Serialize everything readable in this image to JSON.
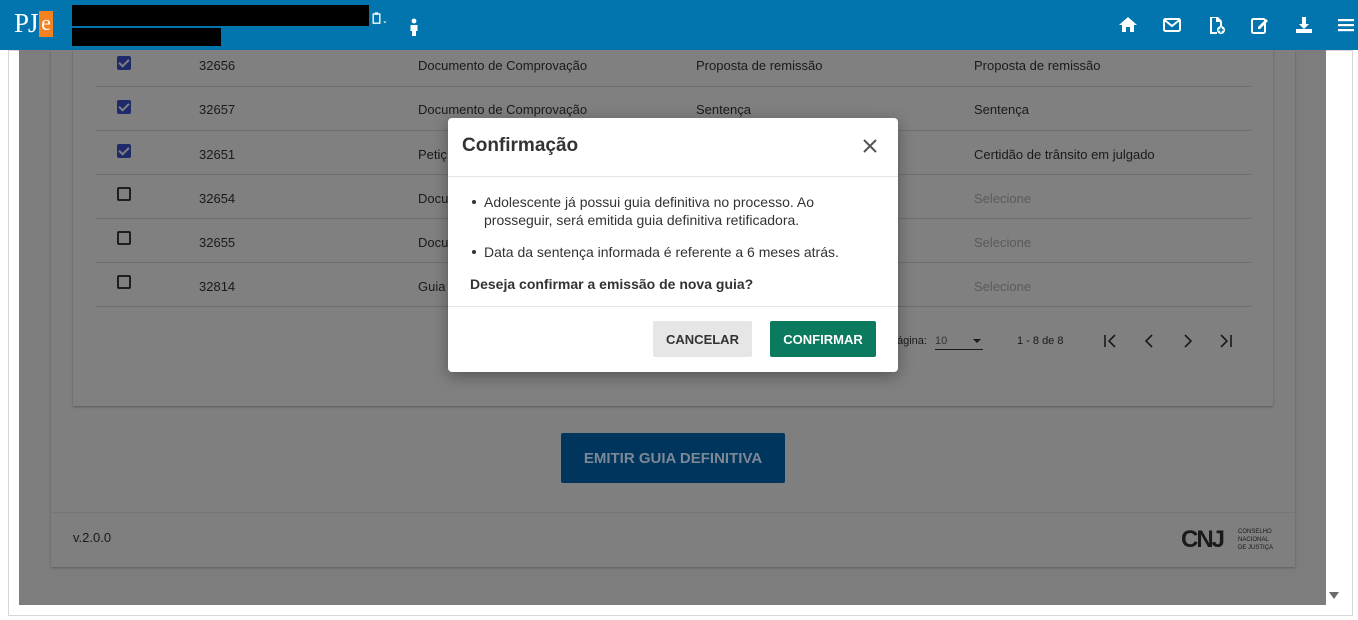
{
  "header": {
    "logo_text": "PJ",
    "logo_accent": "e",
    "bg_color": "#0275ae",
    "icons": [
      "document-dropdown-icon",
      "person-icon",
      "home-icon",
      "mail-icon",
      "document-add-icon",
      "edit-icon",
      "download-icon",
      "menu-icon"
    ]
  },
  "table": {
    "rows": [
      {
        "id": "32656",
        "doc": "Documento de Comprovação",
        "type": "Proposta de remissão",
        "sel": "Proposta de remissão",
        "checked": true
      },
      {
        "id": "32657",
        "doc": "Documento de Comprovação",
        "type": "Sentença",
        "sel": "Sentença",
        "checked": true
      },
      {
        "id": "32651",
        "doc": "Petiç",
        "type": "",
        "sel": "Certidão de trânsito em julgado",
        "checked": true
      },
      {
        "id": "32654",
        "doc": "Docu",
        "type": "",
        "sel": "Selecione",
        "checked": false
      },
      {
        "id": "32655",
        "doc": "Docu",
        "type": "",
        "sel": "Selecione",
        "checked": false
      },
      {
        "id": "32814",
        "doc": "Guia",
        "type": "",
        "sel": "Selecione",
        "checked": false
      }
    ]
  },
  "pager": {
    "per_page_label": "ágina:",
    "per_page_value": "10",
    "range": "1 - 8 de 8"
  },
  "main": {
    "emit_label": "EMITIR GUIA DEFINITIVA",
    "version": "v.2.0.0",
    "cnj_mark": "CNJ",
    "cnj_text_1": "CONSELHO",
    "cnj_text_2": "NACIONAL",
    "cnj_text_3": "DE JUSTIÇA"
  },
  "modal": {
    "title": "Confirmação",
    "items": [
      "Adolescente já possui guia definitiva no processo. Ao prosseguir, será emitida guia definitiva retificadora.",
      "Data da sentença informada é referente a 6 meses atrás."
    ],
    "question": "Deseja confirmar a emissão de nova guia?",
    "cancel_label": "CANCELAR",
    "confirm_label": "CONFIRMAR",
    "confirm_color": "#0b7a5e"
  }
}
